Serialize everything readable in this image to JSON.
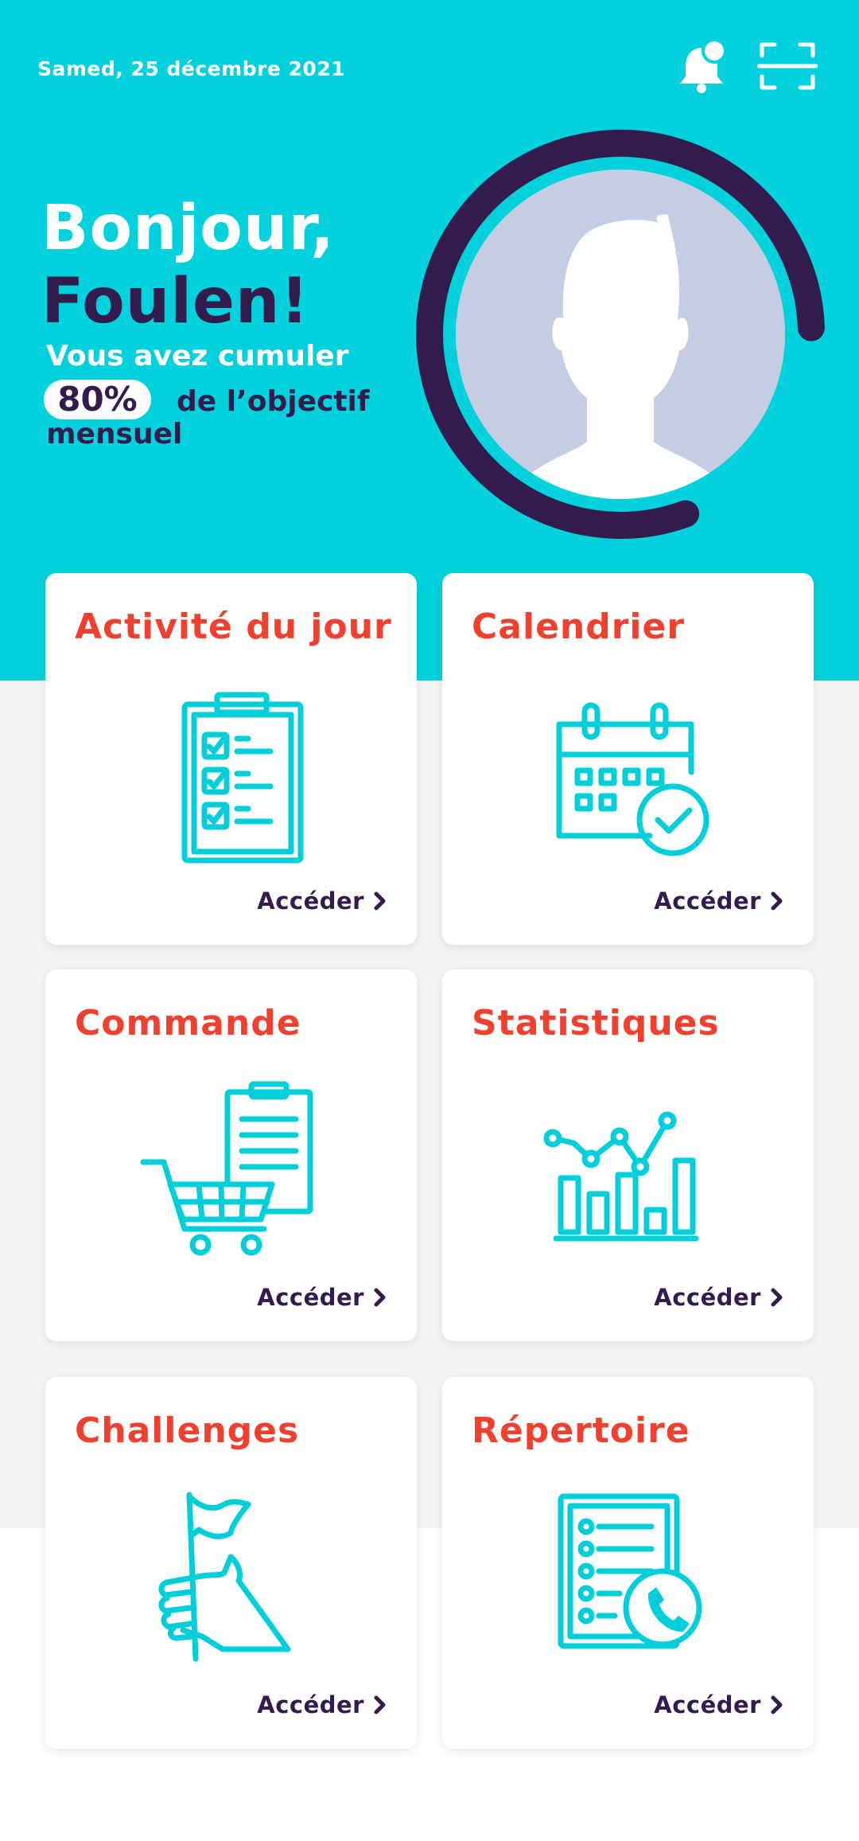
{
  "header": {
    "date": "Samed, 25 décembre 2021"
  },
  "greeting": {
    "hello": "Bonjour,",
    "name": "Foulen!",
    "line1": "Vous avez cumuler",
    "percent": "80%",
    "line2": "de l’objectif",
    "line3": "mensuel",
    "progress": 0.8
  },
  "cards": [
    {
      "title": "Activité du jour",
      "link": "Accéder",
      "icon": "checklist-clipboard-icon"
    },
    {
      "title": "Calendrier",
      "link": "Accéder",
      "icon": "calendar-check-icon"
    },
    {
      "title": "Commande",
      "link": "Accéder",
      "icon": "shopping-cart-order-icon"
    },
    {
      "title": "Statistiques",
      "link": "Accéder",
      "icon": "bar-line-chart-icon"
    },
    {
      "title": "Challenges",
      "link": "Accéder",
      "icon": "hand-flag-icon"
    },
    {
      "title": "Répertoire",
      "link": "Accéder",
      "icon": "phone-directory-icon"
    }
  ],
  "colors": {
    "primary": "#00D1DC",
    "dark": "#321C4E",
    "accent": "#F0402F",
    "avatar_bg": "#C5CDE2"
  }
}
